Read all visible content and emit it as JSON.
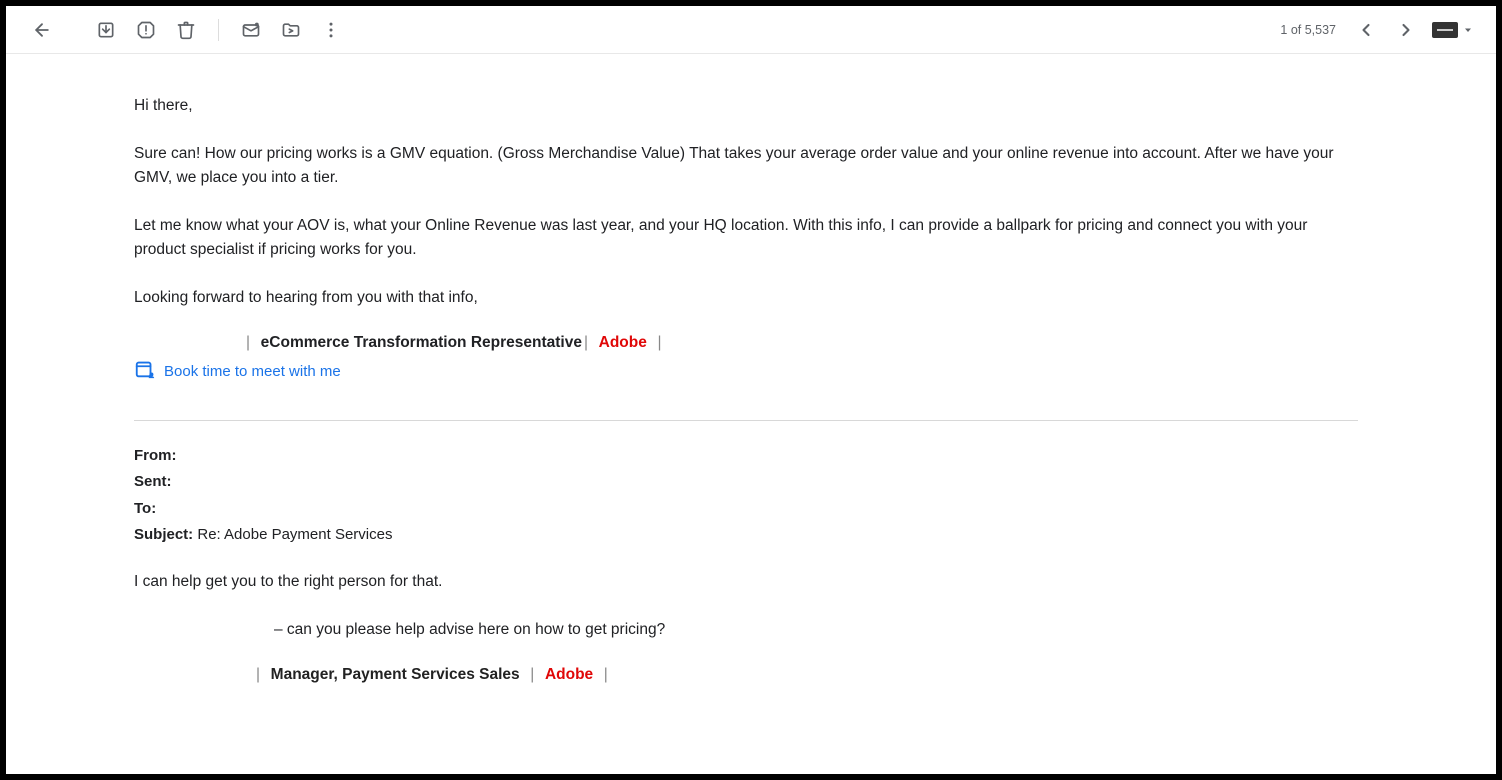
{
  "toolbar": {
    "pager": "1 of 5,537"
  },
  "email": {
    "greeting": "Hi there,",
    "p1": "Sure can! How our pricing works is a GMV equation. (Gross Merchandise Value) That takes your average order value and your online revenue into account. After we have your GMV, we place you into a tier.",
    "p2": "Let me know what your AOV is, what your Online Revenue was last year, and your HQ location. With this info, I can provide a ballpark for pricing and connect you with your product specialist if pricing works for you.",
    "p3": "Looking forward to hearing from you with that info,",
    "signature": {
      "sep": "|",
      "role": "eCommerce Transformation Representative",
      "company": "Adobe",
      "book_label": "Book time to meet with me"
    }
  },
  "quoted": {
    "headers": {
      "from_label": "From:",
      "from_value": "",
      "sent_label": "Sent:",
      "sent_value": "",
      "to_label": "To:",
      "to_value": "",
      "subject_label": "Subject:",
      "subject_value": "Re: Adobe Payment Services"
    },
    "line1": "I can help get you to the right person for that.",
    "line2": "– can you please help advise here on how to get pricing?",
    "signature": {
      "sep": "|",
      "role": "Manager, Payment Services Sales",
      "company": "Adobe"
    }
  }
}
